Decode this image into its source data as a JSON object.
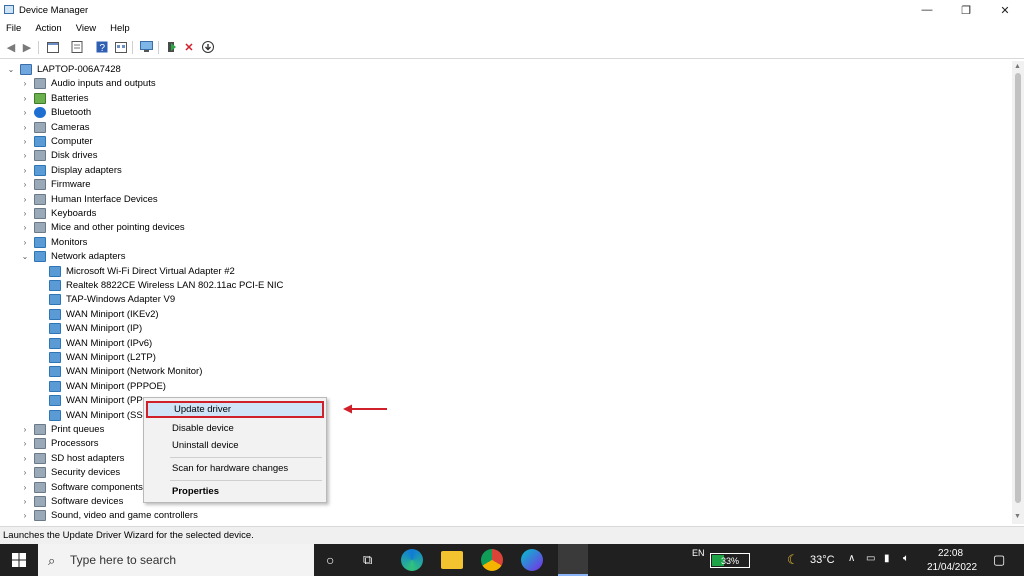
{
  "window": {
    "title": "Device Manager"
  },
  "menu": [
    "File",
    "Action",
    "View",
    "Help"
  ],
  "tree": {
    "root": "LAPTOP-006A7428",
    "categories": [
      "Audio inputs and outputs",
      "Batteries",
      "Bluetooth",
      "Cameras",
      "Computer",
      "Disk drives",
      "Display adapters",
      "Firmware",
      "Human Interface Devices",
      "Keyboards",
      "Mice and other pointing devices",
      "Monitors",
      "Network adapters"
    ],
    "network_adapters": [
      "Microsoft Wi-Fi Direct Virtual Adapter #2",
      "Realtek 8822CE Wireless LAN 802.11ac PCI-E NIC",
      "TAP-Windows Adapter V9",
      "WAN Miniport (IKEv2)",
      "WAN Miniport (IP)",
      "WAN Miniport (IPv6)",
      "WAN Miniport (L2TP)",
      "WAN Miniport (Network Monitor)",
      "WAN Miniport (PPPOE)",
      "WAN Miniport (PP",
      "WAN Miniport (SS"
    ],
    "categories_after": [
      "Print queues",
      "Processors",
      "SD host adapters",
      "Security devices",
      "Software components",
      "Software devices",
      "Sound, video and game controllers"
    ]
  },
  "context_menu": {
    "update": "Update driver",
    "disable": "Disable device",
    "uninstall": "Uninstall device",
    "scan": "Scan for hardware changes",
    "properties": "Properties"
  },
  "status": "Launches the Update Driver Wizard for the selected device.",
  "taskbar": {
    "search_placeholder": "Type here to search",
    "lang": "EN",
    "battery": "33%",
    "battery_level": 0.33,
    "temp": "33°C",
    "time": "22:08",
    "date": "21/04/2022"
  },
  "colors": {
    "highlight_border": "#d0202a",
    "selection": "#cfe4f7",
    "taskbar": "#202020"
  }
}
